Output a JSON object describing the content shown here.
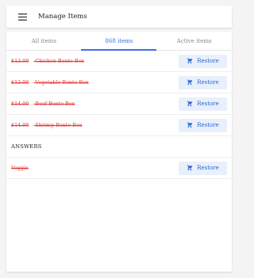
{
  "header": {
    "title": "Manage Items",
    "menu_icon": "hamburger-menu-icon"
  },
  "tabs": [
    {
      "label": "All items",
      "active": false
    },
    {
      "label": "868 items",
      "active": true
    },
    {
      "label": "Active items",
      "active": false
    }
  ],
  "deleted_items": [
    {
      "price": "$12.00",
      "name": "Chicken Bento Box",
      "action": "Restore"
    },
    {
      "price": "$12.00",
      "name": "Vegetable Bento Box",
      "action": "Restore"
    },
    {
      "price": "$14.00",
      "name": "Beef Bento Box",
      "action": "Restore"
    },
    {
      "price": "$14.00",
      "name": "Shrimp Bento Box",
      "action": "Restore"
    }
  ],
  "answers_section": {
    "label": "ANSWERS",
    "items": [
      {
        "name": "Veggie",
        "action": "Restore"
      }
    ]
  },
  "colors": {
    "accent": "#3f6ee0",
    "deleted_text": "#e53935",
    "restore_bg": "#e8f0fb"
  }
}
